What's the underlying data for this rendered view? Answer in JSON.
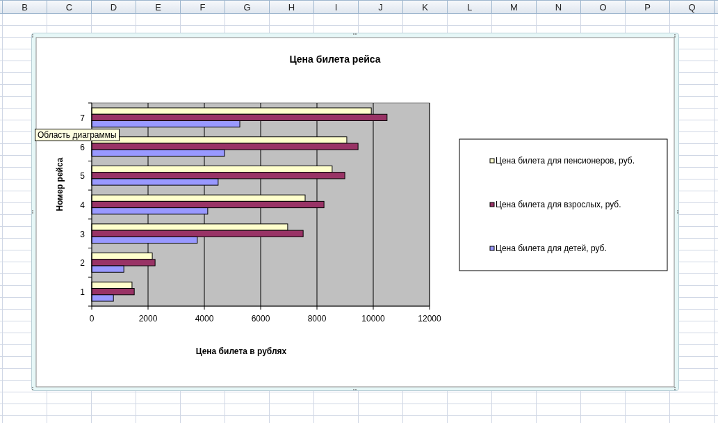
{
  "sheet": {
    "columns": [
      "B",
      "C",
      "D",
      "E",
      "F",
      "G",
      "H",
      "I",
      "J",
      "K",
      "L",
      "M",
      "N",
      "O",
      "P",
      "Q"
    ]
  },
  "chart": {
    "tooltip": "Область диаграммы",
    "chart_data": {
      "type": "bar",
      "orientation": "horizontal",
      "title": "Цена билета рейса",
      "xlabel": "Цена билета  в рублях",
      "ylabel": "Номер рейса",
      "categories": [
        "7",
        "6",
        "5",
        "4",
        "3",
        "2",
        "1"
      ],
      "series": [
        {
          "name": "Цена билета для пенсионеров, руб.",
          "color": "#ffffcc",
          "values": [
            9930,
            9060,
            8540,
            7580,
            6960,
            2150,
            1430
          ]
        },
        {
          "name": "Цена билета для взрослых, руб.",
          "color": "#993366",
          "values": [
            10490,
            9460,
            8990,
            8250,
            7510,
            2250,
            1510
          ]
        },
        {
          "name": "Цена билета для детей, руб.",
          "color": "#9999ff",
          "values": [
            5260,
            4720,
            4490,
            4120,
            3750,
            1140,
            770
          ]
        }
      ],
      "grid": true,
      "legend": true,
      "xlim": [
        0,
        12000
      ],
      "xticks": [
        0,
        2000,
        4000,
        6000,
        8000,
        10000,
        12000
      ]
    }
  }
}
